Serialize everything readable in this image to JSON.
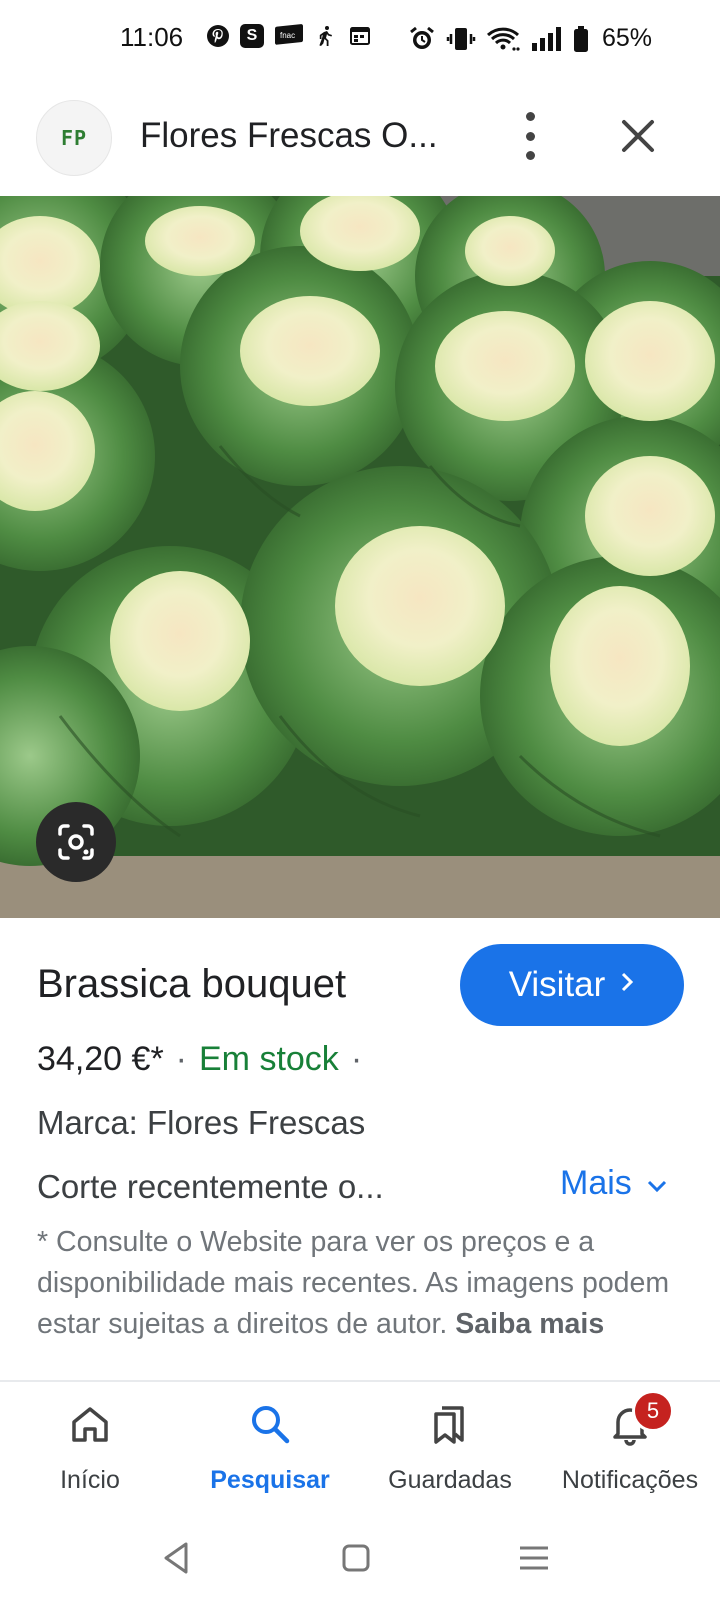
{
  "status_bar": {
    "time": "11:06",
    "notification_icons": [
      "pinterest-icon",
      "s-app-icon",
      "fnac-icon",
      "walking-icon",
      "calendar-icon"
    ],
    "fnac_label": "fnac",
    "s_label": "S",
    "system_icons": [
      "alarm-icon",
      "vibrate-icon",
      "wifi-icon",
      "signal-icon",
      "battery-icon"
    ],
    "battery": "65%"
  },
  "header": {
    "logo_text": "FP",
    "title": "Flores Frescas O...",
    "more_icon": "more-vert-icon",
    "close_icon": "close-icon"
  },
  "image": {
    "lens_icon": "google-lens-icon"
  },
  "product": {
    "name": "Brassica bouquet",
    "visit_label": "Visitar",
    "price": "34,20 €*",
    "separator": "·",
    "stock": "Em stock",
    "brand": "Marca: Flores Frescas",
    "description": "Corte recentemente o...",
    "more_label": "Mais",
    "disclaimer": "* Consulte o Website para ver os preços e a disponibilidade mais recentes. As imagens podem estar sujeitas a direitos de autor.",
    "learn_more": "Saiba mais"
  },
  "colors": {
    "accent": "#1a73e8",
    "stock": "#188038",
    "badge": "#c5221f"
  },
  "bottom_nav": {
    "items": [
      {
        "label": "Início",
        "icon": "home-icon"
      },
      {
        "label": "Pesquisar",
        "icon": "search-icon",
        "active": true
      },
      {
        "label": "Guardadas",
        "icon": "collections-icon"
      },
      {
        "label": "Notificações",
        "icon": "bell-icon",
        "badge": "5"
      }
    ]
  },
  "system_nav": {
    "icons": [
      "back-icon",
      "home-square-icon",
      "recents-menu-icon"
    ]
  }
}
